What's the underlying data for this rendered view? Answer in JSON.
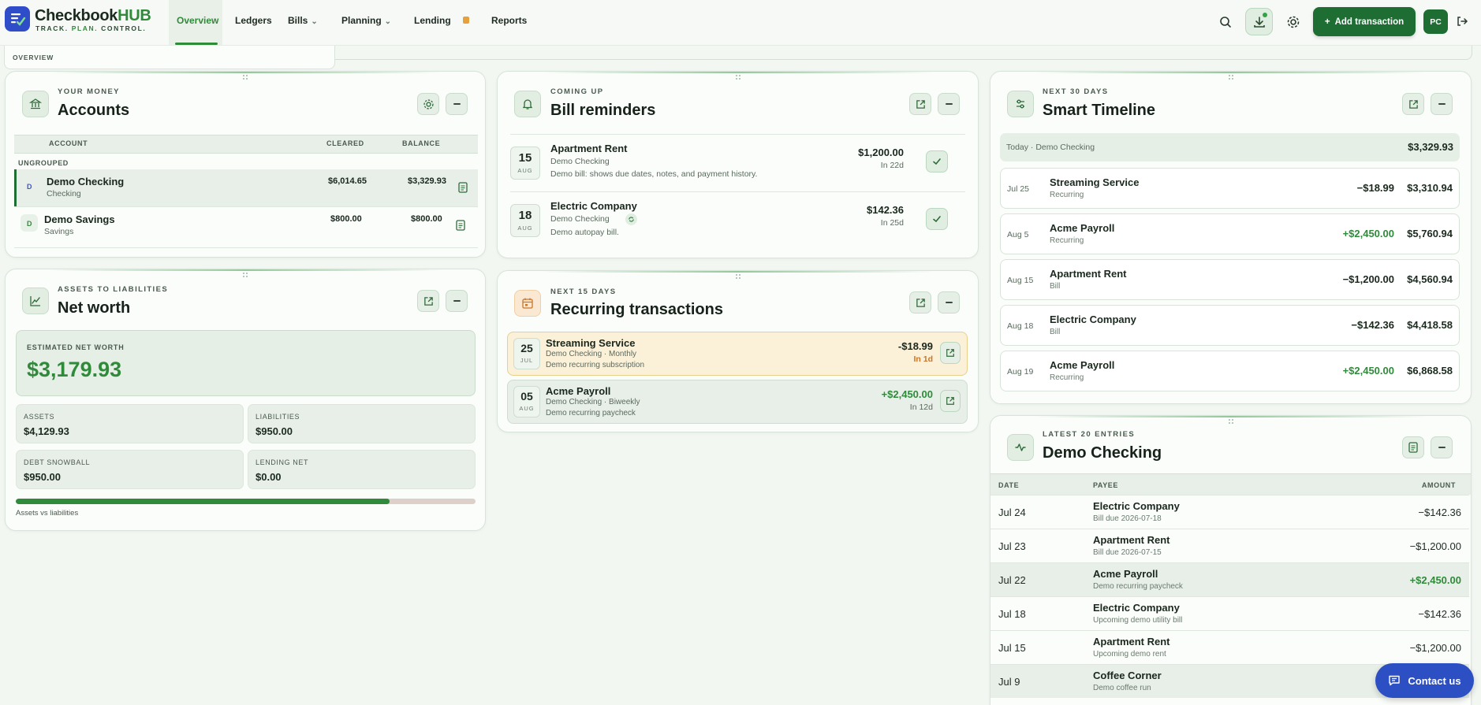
{
  "brand": {
    "name_main": "Checkbook",
    "name_accent": "HUB",
    "tag_1": "TRACK.",
    "tag_2": "PLAN.",
    "tag_3": "CONTROL."
  },
  "nav": {
    "overview": "Overview",
    "ledgers": "Ledgers",
    "bills": "Bills",
    "planning": "Planning",
    "lending": "Lending",
    "reports": "Reports",
    "add_transaction": "Add transaction",
    "avatar": "PC"
  },
  "breadcrumb": "OVERVIEW",
  "accounts": {
    "eyebrow": "YOUR MONEY",
    "title": "Accounts",
    "col_account": "ACCOUNT",
    "col_cleared": "CLEARED",
    "col_balance": "BALANCE",
    "group": "UNGROUPED",
    "rows": [
      {
        "initial": "D",
        "name": "Demo Checking",
        "type": "Checking",
        "cleared": "$6,014.65",
        "balance": "$3,329.93"
      },
      {
        "initial": "D",
        "name": "Demo Savings",
        "type": "Savings",
        "cleared": "$800.00",
        "balance": "$800.00"
      }
    ]
  },
  "networth": {
    "eyebrow": "ASSETS TO LIABILITIES",
    "title": "Net worth",
    "est_label": "ESTIMATED NET WORTH",
    "est_value": "$3,179.93",
    "assets_label": "ASSETS",
    "assets_value": "$4,129.93",
    "liab_label": "LIABILITIES",
    "liab_value": "$950.00",
    "debt_label": "DEBT SNOWBALL",
    "debt_value": "$950.00",
    "lending_label": "LENDING NET",
    "lending_value": "$0.00",
    "bar_caption": "Assets vs liabilities",
    "assets_ratio": 0.813
  },
  "bills": {
    "eyebrow": "COMING UP",
    "title": "Bill reminders",
    "rows": [
      {
        "day": "15",
        "month": "AUG",
        "name": "Apartment Rent",
        "account": "Demo Checking",
        "note": "Demo bill: shows due dates, notes, and payment history.",
        "amount": "$1,200.00",
        "due": "In 22d"
      },
      {
        "day": "18",
        "month": "AUG",
        "name": "Electric Company",
        "account": "Demo Checking",
        "note": "Demo autopay bill.",
        "amount": "$142.36",
        "due": "In 25d"
      }
    ]
  },
  "recurring": {
    "eyebrow": "NEXT 15 DAYS",
    "title": "Recurring transactions",
    "rows": [
      {
        "day": "25",
        "month": "JUL",
        "name": "Streaming Service",
        "meta": "Demo Checking · Monthly",
        "note": "Demo recurring subscription",
        "amount": "-$18.99",
        "due": "In 1d"
      },
      {
        "day": "05",
        "month": "AUG",
        "name": "Acme Payroll",
        "meta": "Demo Checking · Biweekly",
        "note": "Demo recurring paycheck",
        "amount": "+$2,450.00",
        "due": "In 12d"
      }
    ]
  },
  "timeline": {
    "eyebrow": "NEXT 30 DAYS",
    "title": "Smart Timeline",
    "today_label": "Today · Demo Checking",
    "today_balance": "$3,329.93",
    "rows": [
      {
        "date": "Jul 25",
        "name": "Streaming Service",
        "sub": "Recurring",
        "amount": "−$18.99",
        "balance": "$3,310.94"
      },
      {
        "date": "Aug 5",
        "name": "Acme Payroll",
        "sub": "Recurring",
        "amount": "+$2,450.00",
        "balance": "$5,760.94"
      },
      {
        "date": "Aug 15",
        "name": "Apartment Rent",
        "sub": "Bill",
        "amount": "−$1,200.00",
        "balance": "$4,560.94"
      },
      {
        "date": "Aug 18",
        "name": "Electric Company",
        "sub": "Bill",
        "amount": "−$142.36",
        "balance": "$4,418.58"
      },
      {
        "date": "Aug 19",
        "name": "Acme Payroll",
        "sub": "Recurring",
        "amount": "+$2,450.00",
        "balance": "$6,868.58"
      }
    ]
  },
  "ledger": {
    "eyebrow": "LATEST 20 ENTRIES",
    "title": "Demo Checking",
    "col_date": "DATE",
    "col_payee": "PAYEE",
    "col_amount": "AMOUNT",
    "rows": [
      {
        "date": "Jul 24",
        "payee": "Electric Company",
        "sub": "Bill due 2026-07-18",
        "amount": "−$142.36"
      },
      {
        "date": "Jul 23",
        "payee": "Apartment Rent",
        "sub": "Bill due 2026-07-15",
        "amount": "−$1,200.00"
      },
      {
        "date": "Jul 22",
        "payee": "Acme Payroll",
        "sub": "Demo recurring paycheck",
        "amount": "+$2,450.00"
      },
      {
        "date": "Jul 18",
        "payee": "Electric Company",
        "sub": "Upcoming demo utility bill",
        "amount": "−$142.36"
      },
      {
        "date": "Jul 15",
        "payee": "Apartment Rent",
        "sub": "Upcoming demo rent",
        "amount": "−$1,200.00"
      },
      {
        "date": "Jul 9",
        "payee": "Coffee Corner",
        "sub": "Demo coffee run",
        "amount": ""
      }
    ]
  },
  "contact": "Contact us",
  "colors": {
    "accent": "#2f8a3a",
    "brand_dark": "#1e6e34",
    "contact": "#2d4fc4",
    "warning": "#e8a13a"
  }
}
